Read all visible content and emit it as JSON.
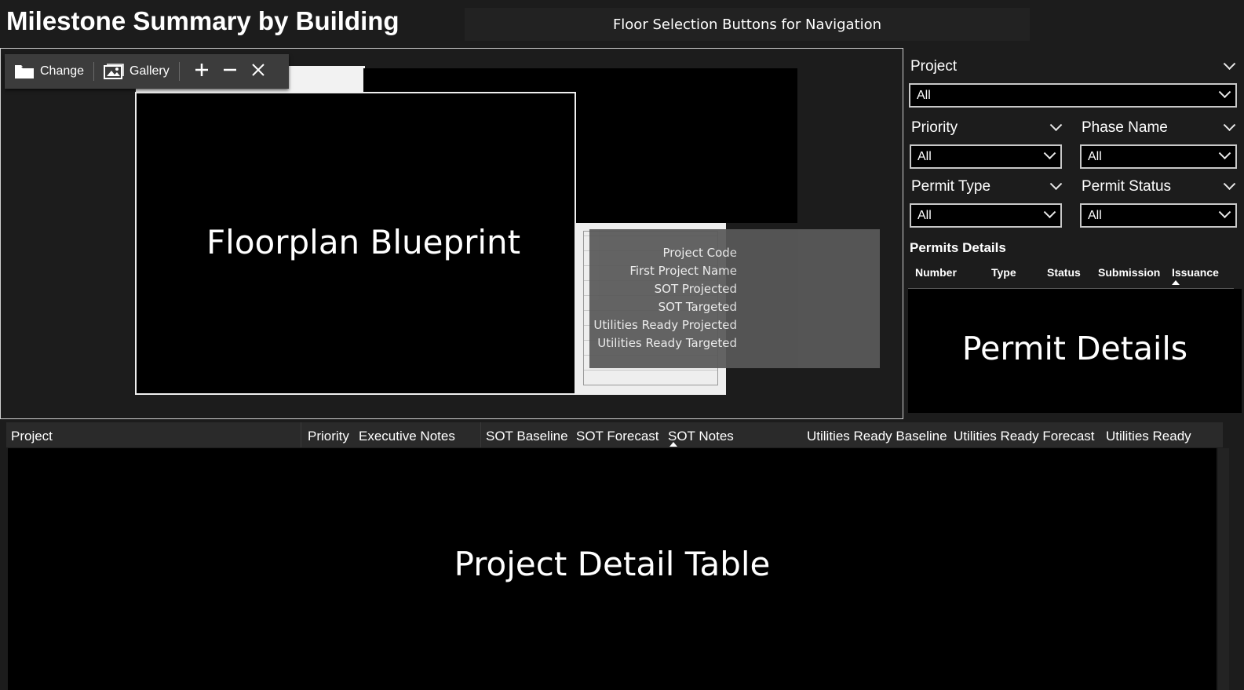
{
  "header": {
    "title": "Milestone Summary by Building",
    "floor_nav": "Floor Selection Buttons for Navigation"
  },
  "toolbar": {
    "change_label": "Change",
    "gallery_label": "Gallery",
    "icons": [
      "folder-icon",
      "gallery-icon",
      "plus-icon",
      "minus-icon",
      "close-icon"
    ]
  },
  "floorplan": {
    "label": "Floorplan Blueprint"
  },
  "tooltip": {
    "lines": [
      "Project Code",
      "First Project Name",
      "SOT Projected",
      "SOT Targeted",
      "Utilities Ready Projected",
      "Utilities Ready Targeted"
    ]
  },
  "filters": {
    "project": {
      "label": "Project",
      "value": "All"
    },
    "priority": {
      "label": "Priority",
      "value": "All"
    },
    "phase_name": {
      "label": "Phase Name",
      "value": "All"
    },
    "permit_type": {
      "label": "Permit Type",
      "value": "All"
    },
    "permit_status": {
      "label": "Permit Status",
      "value": "All"
    }
  },
  "permits": {
    "title": "Permits Details",
    "columns": [
      "Number",
      "Type",
      "Status",
      "Submission",
      "Issuance"
    ],
    "sorted_column": "Issuance",
    "label": "Permit Details"
  },
  "table": {
    "columns": [
      "Project",
      "Priority",
      "Executive Notes",
      "SOT Baseline",
      "SOT Forecast",
      "SOT Notes",
      "Utilities Ready Baseline",
      "Utilities Ready Forecast",
      "Utilities Ready"
    ],
    "sorted_column": "SOT Notes",
    "label": "Project Detail Table"
  },
  "colors": {
    "background": "#1c1c1c",
    "panel_black": "#000000",
    "tooltip_bg": "#595959",
    "toolbar_bg": "#3c3c3c"
  }
}
